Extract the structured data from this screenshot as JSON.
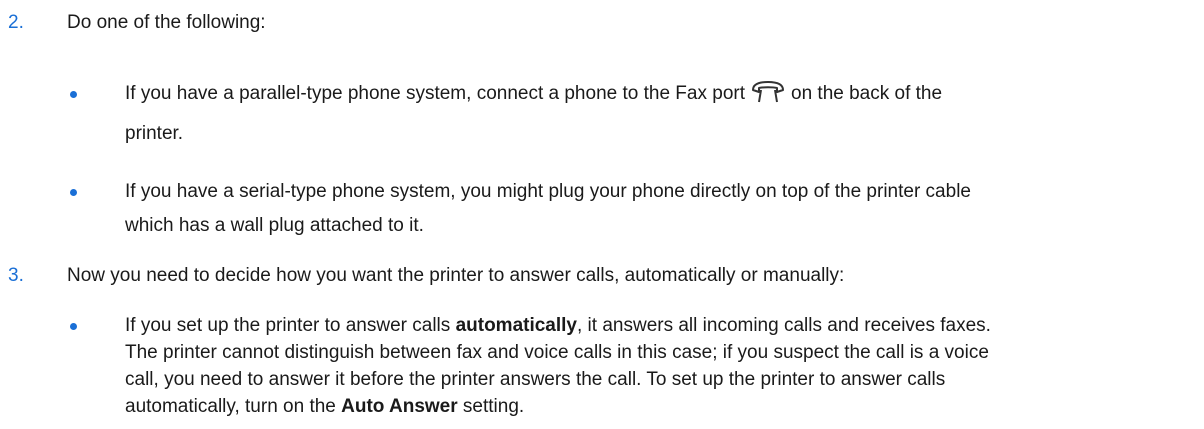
{
  "step2": {
    "number": "2.",
    "text": "Do one of the following:",
    "bullets": [
      {
        "before_icon": "If you have a parallel-type phone system, connect a phone to the Fax port",
        "icon": "phone-port-icon",
        "after_icon": "on the back of the",
        "line2": "printer."
      },
      {
        "line1": "If you have a serial-type phone system, you might plug your phone directly on top of the printer cable",
        "line2": "which has a wall plug attached to it."
      }
    ]
  },
  "step3": {
    "number": "3.",
    "text": "Now you need to decide how you want the printer to answer calls, automatically or manually:",
    "bullet": {
      "l1_a": "If you set up the printer to answer calls ",
      "l1_bold": "automatically",
      "l1_b": ", it answers all incoming calls and receives faxes.",
      "l2": "The printer cannot distinguish between fax and voice calls in this case; if you suspect the call is a voice",
      "l3": "call, you need to answer it before the printer answers the call. To set up the printer to answer calls",
      "l4_a": "automatically, turn on the ",
      "l4_bold": "Auto Answer",
      "l4_b": " setting."
    }
  },
  "colors": {
    "accent": "#1a6fd6",
    "text": "#1a1a1a"
  }
}
